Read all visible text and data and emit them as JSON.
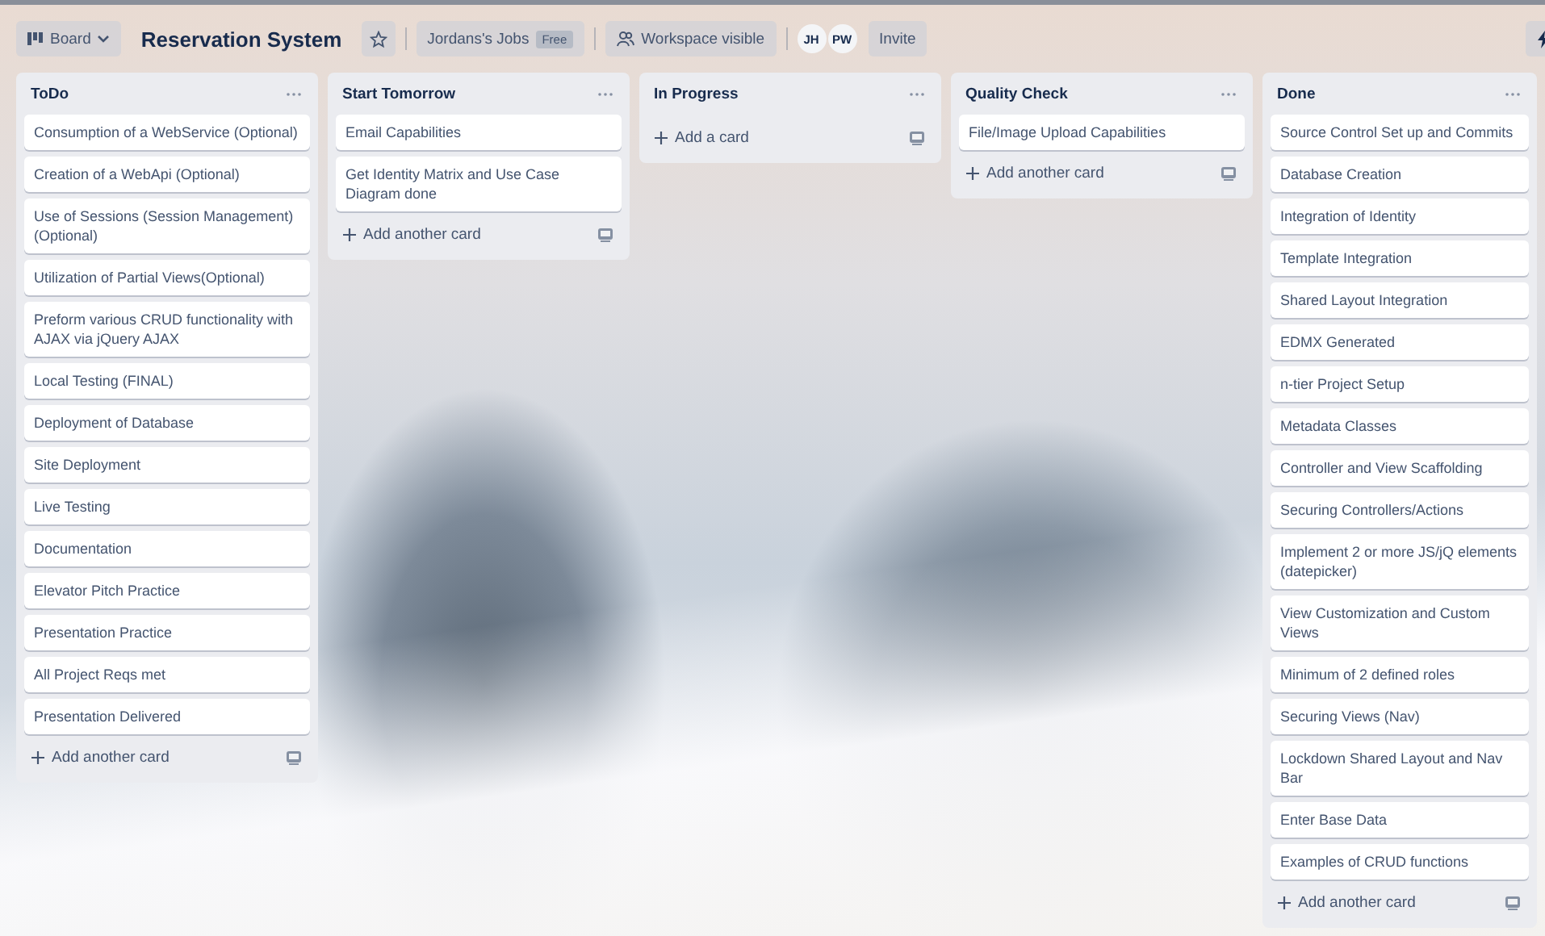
{
  "header": {
    "board_button": "Board",
    "title": "Reservation System",
    "workspace": "Jordans's Jobs",
    "plan_badge": "Free",
    "visibility": "Workspace visible",
    "members": [
      {
        "initials": "JH"
      },
      {
        "initials": "PW"
      }
    ],
    "invite": "Invite"
  },
  "lists": [
    {
      "title": "ToDo",
      "cards": [
        "Consumption of a WebService (Optional)",
        "Creation of a WebApi (Optional)",
        "Use of Sessions (Session Management) (Optional)",
        "Utilization of Partial Views(Optional)",
        "Preform various CRUD functionality with AJAX via jQuery AJAX",
        "Local Testing (FINAL)",
        "Deployment of Database",
        "Site Deployment",
        "Live Testing",
        "Documentation",
        "Elevator Pitch Practice",
        "Presentation Practice",
        "All Project Reqs met",
        "Presentation Delivered"
      ],
      "add_label": "Add another card"
    },
    {
      "title": "Start Tomorrow",
      "cards": [
        "Email Capabilities",
        "Get Identity Matrix and Use Case Diagram done"
      ],
      "add_label": "Add another card"
    },
    {
      "title": "In Progress",
      "add_label": "Add a card"
    },
    {
      "title": "Quality Check",
      "cards": [
        "File/Image Upload Capabilities"
      ],
      "add_label": "Add another card"
    },
    {
      "title": "Done",
      "cards": [
        "Source Control Set up and Commits",
        "Database Creation",
        "Integration of Identity",
        "Template Integration",
        "Shared Layout Integration",
        "EDMX Generated",
        "n-tier Project Setup",
        "Metadata Classes",
        "Controller and View Scaffolding",
        "Securing Controllers/Actions",
        "Implement 2 or more JS/jQ elements (datepicker)",
        "View Customization and Custom Views",
        "Minimum of 2 defined roles",
        "Securing Views (Nav)",
        "Lockdown Shared Layout and Nav Bar",
        "Enter Base Data",
        "Examples of CRUD functions"
      ],
      "add_label": "Add another card"
    }
  ]
}
